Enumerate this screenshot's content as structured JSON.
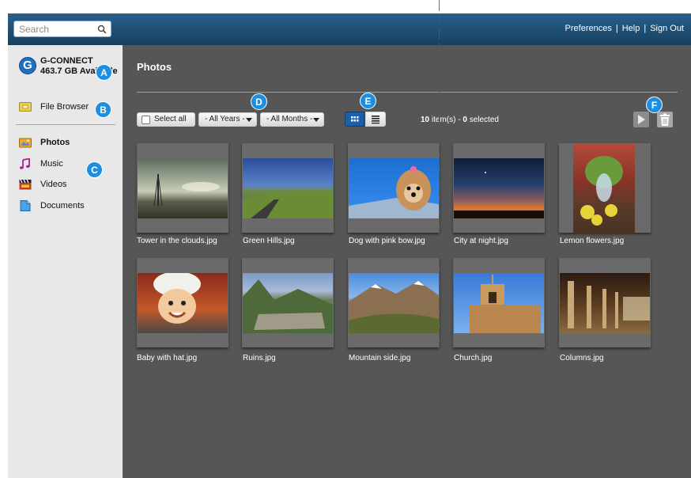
{
  "search": {
    "placeholder": "Search"
  },
  "header_links": {
    "preferences": "Preferences",
    "help": "Help",
    "sign_out": "Sign Out",
    "separator": "|"
  },
  "drive": {
    "name": "G-CONNECT",
    "available": "463.7 GB Available"
  },
  "sidebar": {
    "file_browser": "File Browser",
    "items": [
      {
        "label": "Photos",
        "icon": "photos-icon",
        "active": true
      },
      {
        "label": "Music",
        "icon": "music-note-icon"
      },
      {
        "label": "Videos",
        "icon": "clapperboard-icon"
      },
      {
        "label": "Documents",
        "icon": "document-icon"
      }
    ]
  },
  "main": {
    "title": "Photos",
    "select_all": "Select all",
    "years_filter": "- All Years -",
    "months_filter": "- All Months -",
    "item_count": "10",
    "item_word": "item(s) -",
    "selected_count": "0",
    "selected_word": "selected",
    "view_mode": "grid"
  },
  "photos": [
    {
      "name": "Tower in the clouds.jpg"
    },
    {
      "name": "Green Hills.jpg"
    },
    {
      "name": "Dog with pink bow.jpg"
    },
    {
      "name": "City at night.jpg"
    },
    {
      "name": "Lemon flowers.jpg"
    },
    {
      "name": "Baby with hat.jpg"
    },
    {
      "name": "Ruins.jpg"
    },
    {
      "name": "Mountain side.jpg"
    },
    {
      "name": "Church.jpg"
    },
    {
      "name": "Columns.jpg"
    }
  ],
  "callouts": {
    "a": "A",
    "b": "B",
    "c": "C",
    "d": "D",
    "e": "E",
    "f": "F"
  },
  "colors": {
    "header": "#1f5380",
    "accent": "#1d8fe0",
    "content_bg": "#565656",
    "sidebar_bg": "#e8e8e8",
    "guide": "#c0206a"
  }
}
